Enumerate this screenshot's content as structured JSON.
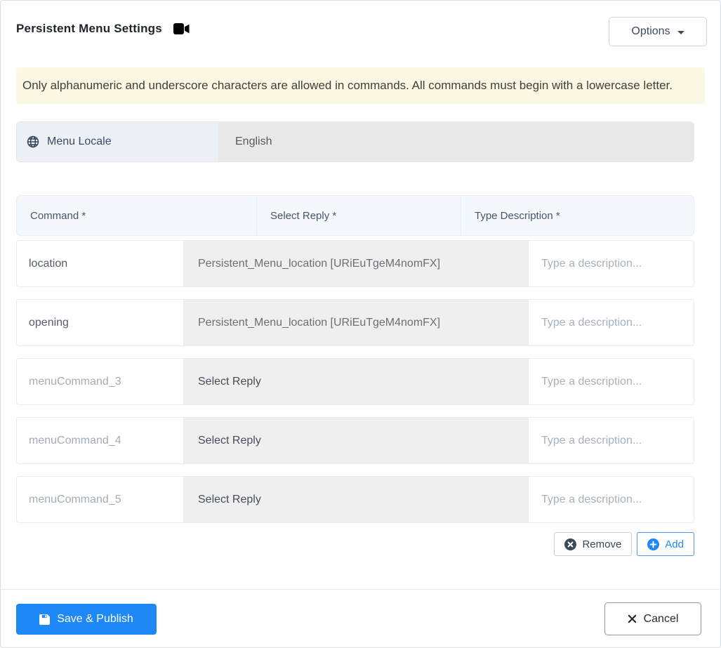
{
  "header": {
    "title": "Persistent Menu Settings",
    "title_icon": "video-camera-icon",
    "options_label": "Options"
  },
  "alert": {
    "text": "Only alphanumeric and underscore characters are allowed in commands. All commands must begin with a lowercase letter."
  },
  "locale": {
    "icon": "globe-icon",
    "label": "Menu Locale",
    "value": "English"
  },
  "table": {
    "columns": [
      "Command *",
      "Select Reply *",
      "Type Description *"
    ],
    "rows": [
      {
        "command": "location",
        "command_filled": true,
        "reply": "Persistent_Menu_location [URiEuTgeM4nomFX]",
        "reply_selected": true,
        "description_placeholder": "Type a description..."
      },
      {
        "command": "opening",
        "command_filled": true,
        "reply": "Persistent_Menu_location [URiEuTgeM4nomFX]",
        "reply_selected": true,
        "description_placeholder": "Type a description..."
      },
      {
        "command": "menuCommand_3",
        "command_filled": false,
        "reply": "Select Reply",
        "reply_selected": false,
        "description_placeholder": "Type a description..."
      },
      {
        "command": "menuCommand_4",
        "command_filled": false,
        "reply": "Select Reply",
        "reply_selected": false,
        "description_placeholder": "Type a description..."
      },
      {
        "command": "menuCommand_5",
        "command_filled": false,
        "reply": "Select Reply",
        "reply_selected": false,
        "description_placeholder": "Type a description..."
      }
    ]
  },
  "row_actions": {
    "remove_label": "Remove",
    "add_label": "Add"
  },
  "footer": {
    "save_label": "Save & Publish",
    "cancel_label": "Cancel"
  },
  "colors": {
    "primary": "#1e88f7",
    "alert_bg": "#fcf8e3",
    "remove_icon": "#3e4956",
    "select_cell_bg": "#efefef",
    "header_bg": "#f4f8fc",
    "locale_label_bg": "#edf1f7",
    "locale_value_bg": "#e9e9e9"
  }
}
